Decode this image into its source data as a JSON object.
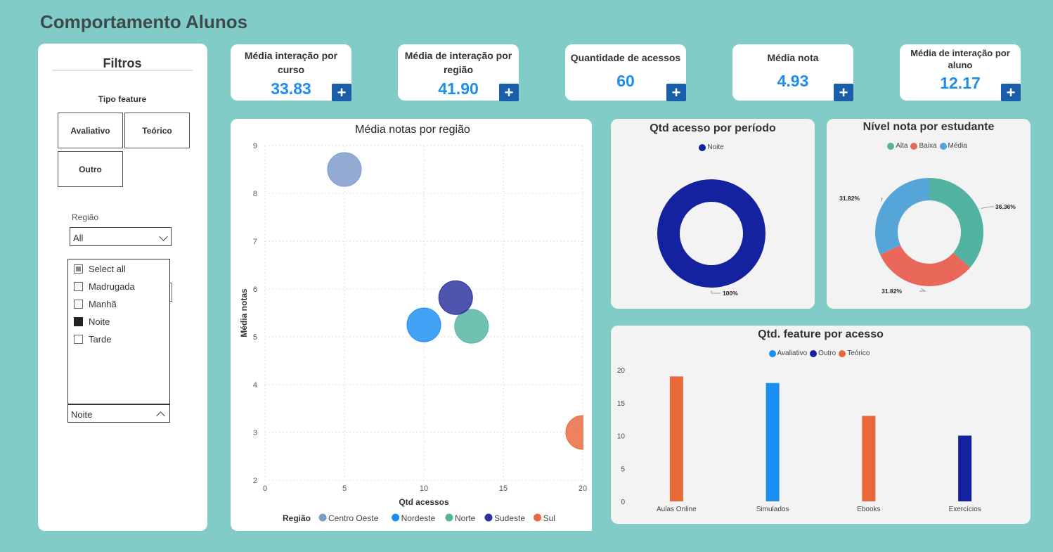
{
  "header": {
    "title": "Comportamento Alunos"
  },
  "filters": {
    "title": "Filtros",
    "tipo_label": "Tipo feature",
    "tiles": [
      "Avaliativo",
      "Teórico",
      "Outro"
    ],
    "regiao_label": "Região",
    "regiao_value": "All",
    "period_options": [
      {
        "label": "Select all",
        "state": "partial"
      },
      {
        "label": "Madrugada",
        "state": "unchecked"
      },
      {
        "label": "Manhã",
        "state": "unchecked"
      },
      {
        "label": "Noite",
        "state": "checked"
      },
      {
        "label": "Tarde",
        "state": "unchecked"
      }
    ],
    "period_selected": "Noite"
  },
  "kpis": [
    {
      "title": "Média interação por curso",
      "value": "33.83"
    },
    {
      "title": "Média de interação por região",
      "value": "41.90"
    },
    {
      "title": "Quantidade de acessos",
      "value": "60"
    },
    {
      "title": "Média nota",
      "value": "4.93"
    },
    {
      "title": "Média de interação por aluno",
      "value": "12.17"
    }
  ],
  "plus_label": "+",
  "colors": {
    "accent": "#1e8dec",
    "plus_button": "#1a5da8",
    "background": "#82ccc7",
    "centro_oeste": "#7b98c9",
    "nordeste": "#1b8ef2",
    "norte": "#52b3a1",
    "sudeste": "#27309e",
    "sul": "#e8683a",
    "noite": "#1422a0",
    "alta": "#52b3a1",
    "baixa": "#e9685a",
    "media": "#56a5d9",
    "avaliativo": "#1b8ef2",
    "outro": "#1422a0",
    "teorico": "#e8683a"
  },
  "chart_data": [
    {
      "type": "scatter",
      "title": "Média notas por região",
      "xlabel": "Qtd acessos",
      "ylabel": "Média notas",
      "xlim": [
        0,
        20
      ],
      "ylim": [
        2,
        9
      ],
      "xticks": [
        "0",
        "5",
        "10",
        "15",
        "20"
      ],
      "yticks": [
        "2",
        "3",
        "4",
        "5",
        "6",
        "7",
        "8",
        "9"
      ],
      "legend_title": "Região",
      "legend_position": "bottom",
      "grid": true,
      "series": [
        {
          "name": "Centro Oeste",
          "x": 5,
          "y": 8.5
        },
        {
          "name": "Nordeste",
          "x": 10,
          "y": 5.25
        },
        {
          "name": "Norte",
          "x": 13,
          "y": 5.22
        },
        {
          "name": "Sudeste",
          "x": 12,
          "y": 5.82
        },
        {
          "name": "Sul",
          "x": 20,
          "y": 3.0
        }
      ]
    },
    {
      "type": "pie",
      "title": "Qtd acesso por período",
      "legend_position": "top",
      "slices": [
        {
          "name": "Noite",
          "value": 100,
          "label": "100%"
        }
      ]
    },
    {
      "type": "pie",
      "title": "Nível nota por estudante",
      "legend_position": "top",
      "slices": [
        {
          "name": "Alta",
          "value": 36.36,
          "label": "36.36%"
        },
        {
          "name": "Baixa",
          "value": 31.82,
          "label": "31.82%"
        },
        {
          "name": "Média",
          "value": 31.82,
          "label": "31.82%"
        }
      ]
    },
    {
      "type": "bar",
      "title": "Qtd. feature por acesso",
      "legend_position": "top",
      "categories": [
        "Aulas Online",
        "Simulados",
        "Ebooks",
        "Exercícios"
      ],
      "ylim": [
        0,
        20
      ],
      "yticks": [
        "0",
        "5",
        "10",
        "15",
        "20"
      ],
      "series": [
        {
          "name": "Avaliativo",
          "values": [
            null,
            18,
            null,
            null
          ]
        },
        {
          "name": "Outro",
          "values": [
            null,
            null,
            null,
            10
          ]
        },
        {
          "name": "Teórico",
          "values": [
            19,
            null,
            13,
            null
          ]
        }
      ]
    }
  ]
}
